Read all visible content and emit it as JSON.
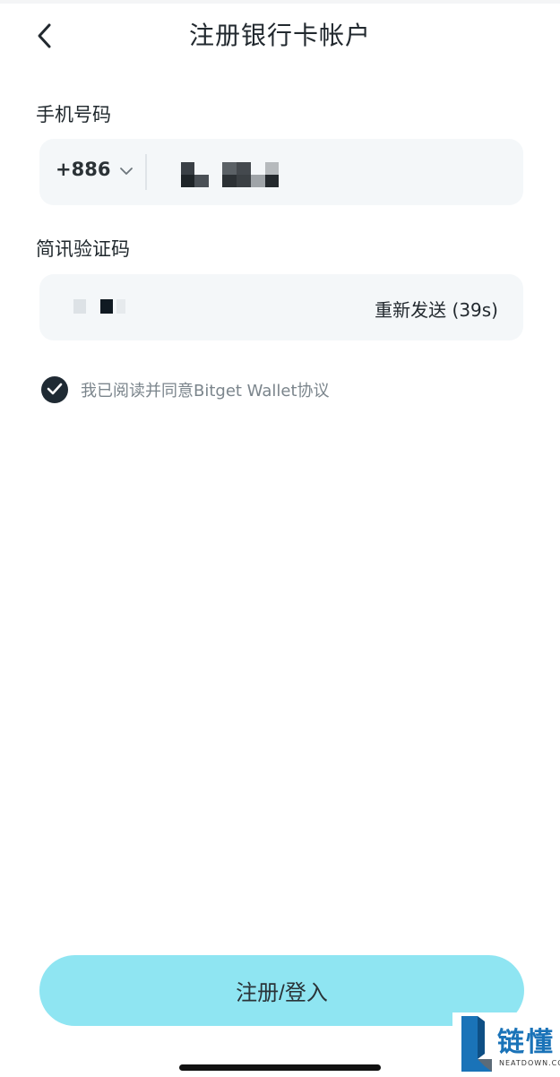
{
  "header": {
    "title": "注册银行卡帐户",
    "back_icon": "chevron-left-icon"
  },
  "phone": {
    "label": "手机号码",
    "country_code": "+886",
    "dropdown_icon": "chevron-down-icon"
  },
  "sms": {
    "label": "简讯验证码",
    "resend_label": "重新发送 (39s)"
  },
  "agreement": {
    "checked": true,
    "text": "我已阅读并同意Bitget Wallet协议"
  },
  "submit": {
    "label": "注册/登入"
  },
  "watermark": {
    "cn": "链懂",
    "en": "NEATDOWN.COM"
  },
  "colors": {
    "primary_button": "#8fe5f2",
    "input_bg": "#f4f7f9",
    "check": "#1f2a33",
    "watermark": "#1a73b8"
  }
}
